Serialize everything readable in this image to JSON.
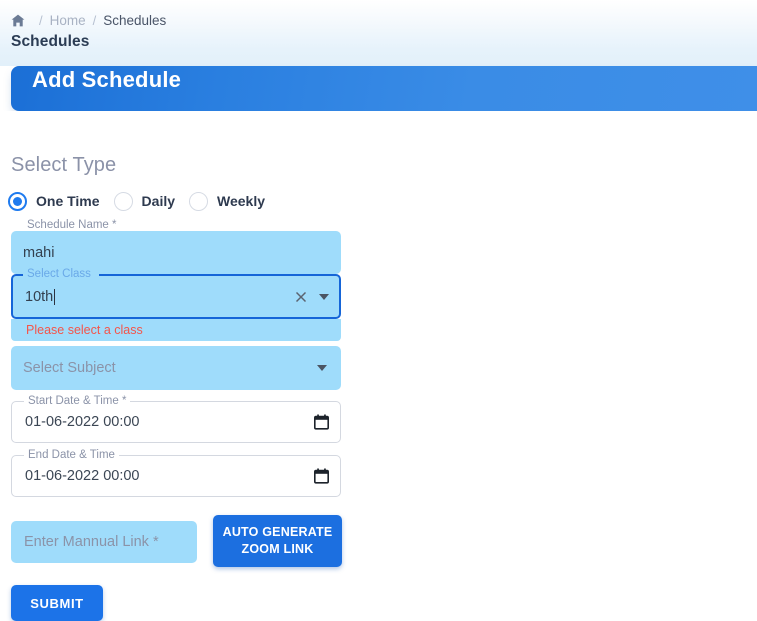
{
  "breadcrumb": {
    "home_icon": "home-icon",
    "separator": "/",
    "home_label": "Home",
    "current_label": "Schedules"
  },
  "page": {
    "title": "Schedules"
  },
  "banner": {
    "title": "Add Schedule",
    "color": "#2a7fe0"
  },
  "form": {
    "select_type_heading": "Select Type",
    "type_options": [
      {
        "label": "One Time",
        "selected": true
      },
      {
        "label": "Daily",
        "selected": false
      },
      {
        "label": "Weekly",
        "selected": false
      }
    ],
    "schedule_name": {
      "label": "Schedule Name *",
      "value": "mahi"
    },
    "select_class": {
      "label": "Select Class",
      "value": "10th",
      "clear_icon": "close-icon",
      "dropdown_icon": "chevron-down-icon",
      "error": "Please select a class",
      "error_color": "#f4554a",
      "focus_color": "#1565d8"
    },
    "select_subject": {
      "placeholder": "Select Subject",
      "dropdown_icon": "chevron-down-icon"
    },
    "start_date": {
      "label": "Start Date & Time *",
      "value": "01-06-2022 00:00",
      "picker_icon": "calendar-icon"
    },
    "end_date": {
      "label": "End Date & Time",
      "value": "01-06-2022 00:00",
      "picker_icon": "calendar-icon"
    },
    "manual_link": {
      "placeholder": "Enter Mannual Link *",
      "value": ""
    },
    "auto_generate_button": "AUTO GENERATE ZOOM LINK",
    "submit_button": "SUBMIT"
  }
}
